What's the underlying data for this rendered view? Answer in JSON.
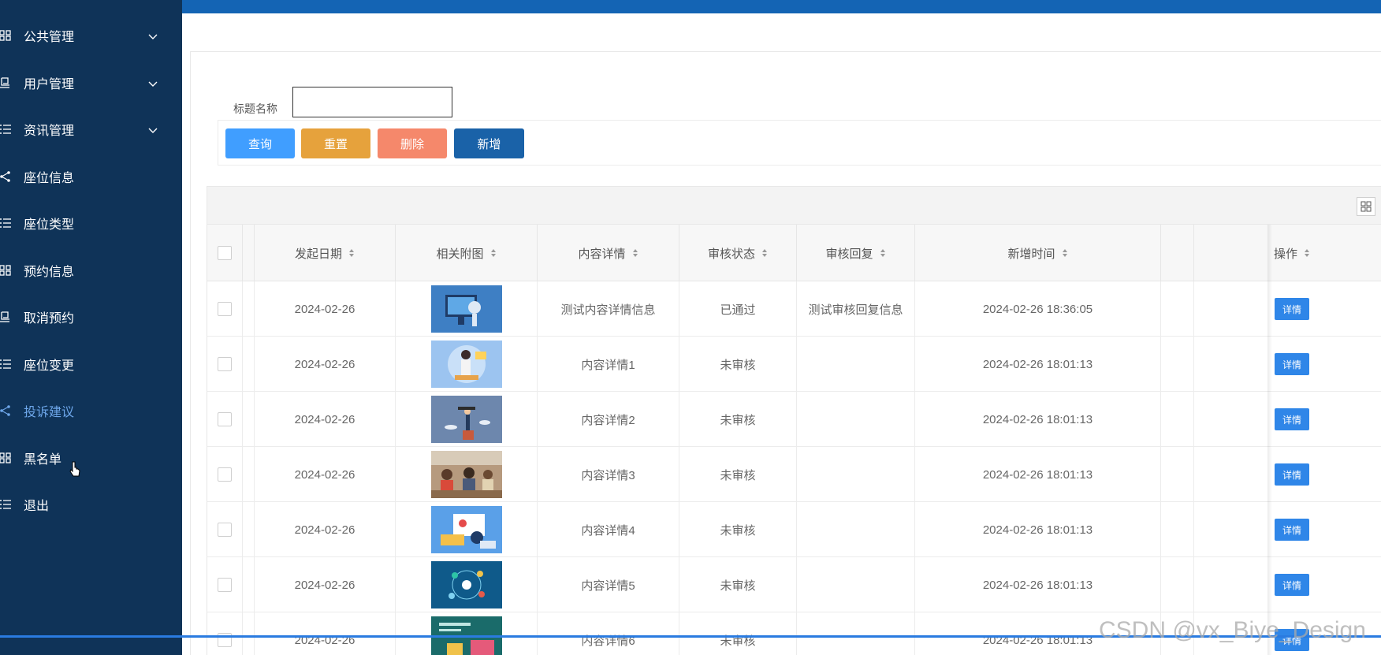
{
  "sidebar": {
    "items": [
      {
        "label": "公共管理",
        "icon": "grid-icon",
        "has_arrow": true
      },
      {
        "label": "用户管理",
        "icon": "monitor-icon",
        "has_arrow": true
      },
      {
        "label": "资讯管理",
        "icon": "list-icon",
        "has_arrow": true
      },
      {
        "label": "座位信息",
        "icon": "share-icon",
        "has_arrow": false
      },
      {
        "label": "座位类型",
        "icon": "list-icon",
        "has_arrow": false
      },
      {
        "label": "预约信息",
        "icon": "grid-icon",
        "has_arrow": false
      },
      {
        "label": "取消预约",
        "icon": "monitor-icon",
        "has_arrow": false
      },
      {
        "label": "座位变更",
        "icon": "list-icon",
        "has_arrow": false
      },
      {
        "label": "投诉建议",
        "icon": "share-icon",
        "has_arrow": false,
        "active": true
      },
      {
        "label": "黑名单",
        "icon": "grid-icon",
        "has_arrow": false
      },
      {
        "label": "退出",
        "icon": "list-icon",
        "has_arrow": false
      }
    ]
  },
  "search": {
    "label": "标题名称",
    "value": "",
    "placeholder": ""
  },
  "buttons": {
    "query": "查询",
    "reset": "重置",
    "delete": "删除",
    "add": "新增"
  },
  "colors": {
    "sidebar_bg": "#0f3358",
    "topbar": "#1464b4",
    "query": "#409eff",
    "reset": "#e6a23c",
    "delete": "#f5886b",
    "add": "#1a62a8",
    "detail": "#2f86e8",
    "active_menu": "#6ea7ea"
  },
  "table": {
    "headers": {
      "date": "发起日期",
      "image": "相关附图",
      "content": "内容详情",
      "status": "审核状态",
      "reply": "审核回复",
      "created": "新增时间",
      "ops": "操作"
    },
    "rows": [
      {
        "date": "2024-02-26",
        "image": "robot-illustration",
        "content": "测试内容详情信息",
        "status": "已通过",
        "reply": "测试审核回复信息",
        "created": "2024-02-26 18:36:05",
        "op": "详情"
      },
      {
        "date": "2024-02-26",
        "image": "teacher-illustration",
        "content": "内容详情1",
        "status": "未审核",
        "reply": "",
        "created": "2024-02-26 18:01:13",
        "op": "详情"
      },
      {
        "date": "2024-02-26",
        "image": "telescope-illustration",
        "content": "内容详情2",
        "status": "未审核",
        "reply": "",
        "created": "2024-02-26 18:01:13",
        "op": "详情"
      },
      {
        "date": "2024-02-26",
        "image": "classroom-photo",
        "content": "内容详情3",
        "status": "未审核",
        "reply": "",
        "created": "2024-02-26 18:01:13",
        "op": "详情"
      },
      {
        "date": "2024-02-26",
        "image": "online-learning-illustration",
        "content": "内容详情4",
        "status": "未审核",
        "reply": "",
        "created": "2024-02-26 18:01:13",
        "op": "详情"
      },
      {
        "date": "2024-02-26",
        "image": "network-illustration",
        "content": "内容详情5",
        "status": "未审核",
        "reply": "",
        "created": "2024-02-26 18:01:13",
        "op": "详情"
      },
      {
        "date": "2024-02-26",
        "image": "slide-illustration",
        "content": "内容详情6",
        "status": "未审核",
        "reply": "",
        "created": "2024-02-26 18:01:13",
        "op": "详情"
      }
    ]
  },
  "watermark": "CSDN @vx_Biye_Design"
}
